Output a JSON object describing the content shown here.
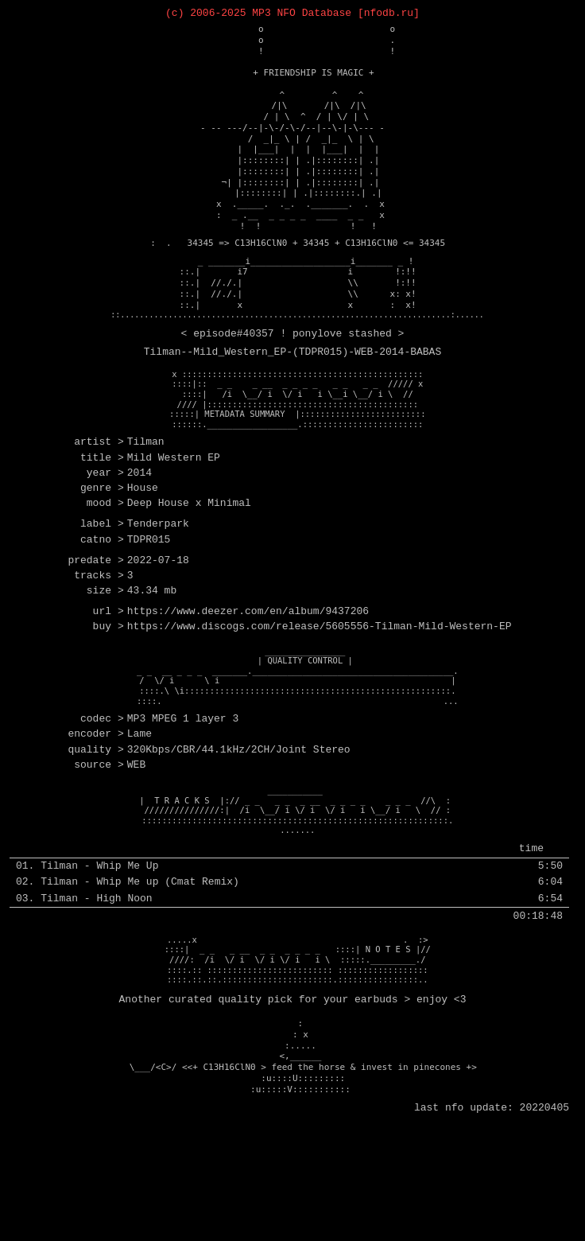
{
  "header": {
    "copyright": "(c) 2006-2025 MP3 NFO Database [nfodb.ru]"
  },
  "ascii": {
    "friendship": "+ FRIENDSHIP IS MAGIC +",
    "art1": "             o                        o\n             o                        .\n             !                        !\n\n        + FRIENDSHIP IS MAGIC +\n\n           ^         ^    ^\n          /|\\       /|\\  /|\\\n         / | \\  ^  / | \\/ | \\\n- -- ---/--|-\\-/-\\-/--|--\\-|-\\--- -\n       /  _|_ \\ | /  _|_  \\ | \\\n      |  |___|  |  |  |___|  |  |\n      |:::::::| | .|::::::::.| .|\n      |:::::::| | .|::::::::.| .|\n   ¬| |:::::::| | .|::::::::.| .|\n      |:::::::| | .|::::::::.|   |\n   x  ._____.  ._.  ._______.  . x\n   :  _ .__  _ _ _ _  ____  _ _  x\n      !  !                 !   !",
    "formula": "  :  .   34345 => C13H16ClN0 + 34345 + C13H16ClN0 <= 34345",
    "art2_pre": "     _ _______i___________________i_______ _ !\n  ::.|       i7                   i        !:!!\n  ::.| //./. |                   \\\\       !:!!\n  ::.| //./. |                   \\\\      x: x!\n  ::.|       x                   x       :  x!",
    "episode": "< episode#40357 ! ponylove stashed >",
    "release": "Tilman--Mild_Western_EP-(TDPR015)-WEB-2014-BABAS",
    "banner_pre": "  x ::::::::::::::::::::::::::::::::::::::::::::::::\n  ::::|::  _ _    _ __  _ _ _ _   _ _   _ _  ///// x\n  ::::|   /i  \\__/ i  \\/ i   i \\__i \\__/ i \\  //\n  //// |::::::::::::::::::::::::::::::::::::::::::\n  :::::| METADATA SUMMARY  |:::::::::::::::::::::::\n  ::::::.__________________.:::::::::::::::::::::::",
    "qc_banner": "     ________________\n     | QUALITY CONTROL |\n  _ _  __ _ _ _  _______.________________________________________.\n  /  \\/ i      \\ i                                              |\n  ::::\\ \\i:::::::::::::::::::::::::::::::::::::::::::::::::::::::.\n  ::::.                                                        ...",
    "tracks_banner": " ___________\n |  T R A C K S  |:// _ _   _ _  _ __  _ _ _ _    _ _ _  //\\  :\n  ///////////////:|  /i  \\__/ i \\/ i  \\/ i   i \\__/ i   \\  // :\n  :::::::::::::::::::::::::::::::::::::::::::::::::::::::::::::.\n  .......",
    "notes_banner": "  .....x                                        .  :>\n  ::::|  _ _   _ __  _ _  _ _ _ _   ::::| N O T E S |//\n  ////:  /i  \\/ i  \\/ i \\/ i   i \\  :::::._________./\n  ::::.:: :::::::::::::::::::::::::: ::::::::::::::::::\n  ::::.::.::.::::::::::::::::::::::: ::::::::::::::::...",
    "footer_art": "   :\n   : x\n   :.....\n   <,______\n    \\___/<C>/ <<+ C13H16ClN0 > feed the horse & invest in pinecones +>\n    :u::::U:::::::::\n   :u:::::V:::::::::::"
  },
  "metadata": {
    "artist": "Tilman",
    "title": "Mild Western EP",
    "year": "2014",
    "genre": "House",
    "mood": "Deep House x Minimal",
    "label": "Tenderpark",
    "catno": "TDPR015",
    "predate": "2022-07-18",
    "tracks": "3",
    "size": "43.34 mb",
    "url": "https://www.deezer.com/en/album/9437206",
    "buy": "https://www.discogs.com/release/5605556-Tilman-Mild-Western-EP"
  },
  "quality": {
    "codec": "MP3 MPEG 1 layer 3",
    "encoder": "Lame",
    "quality": "320Kbps/CBR/44.1kHz/2CH/Joint Stereo",
    "source": "WEB"
  },
  "tracklist": {
    "header": "time",
    "tracks": [
      {
        "num": "01.",
        "title": "Tilman - Whip Me Up",
        "time": "5:50"
      },
      {
        "num": "02.",
        "title": "Tilman - Whip Me up (Cmat Remix)",
        "time": "6:04"
      },
      {
        "num": "03.",
        "title": "Tilman - High Noon",
        "time": "6:54"
      }
    ],
    "total": "00:18:48"
  },
  "notes": {
    "text": "Another curated quality pick for your earbuds > enjoy <3"
  },
  "footer": {
    "update": "last nfo update: 20220405"
  },
  "labels": {
    "metadata_section": "METADATA SUMMARY",
    "qc_section": "QUALITY CONTROL",
    "tracks_section": "T R A C K S",
    "notes_section": "N O T E S",
    "artist_key": "artist",
    "title_key": "title",
    "year_key": "year",
    "genre_key": "genre",
    "mood_key": "mood",
    "label_key": "label",
    "catno_key": "catno",
    "predate_key": "predate",
    "tracks_key": "tracks",
    "size_key": "size",
    "url_key": "url",
    "buy_key": "buy",
    "codec_key": "codec",
    "encoder_key": "encoder",
    "quality_key": "quality",
    "source_key": "source"
  }
}
